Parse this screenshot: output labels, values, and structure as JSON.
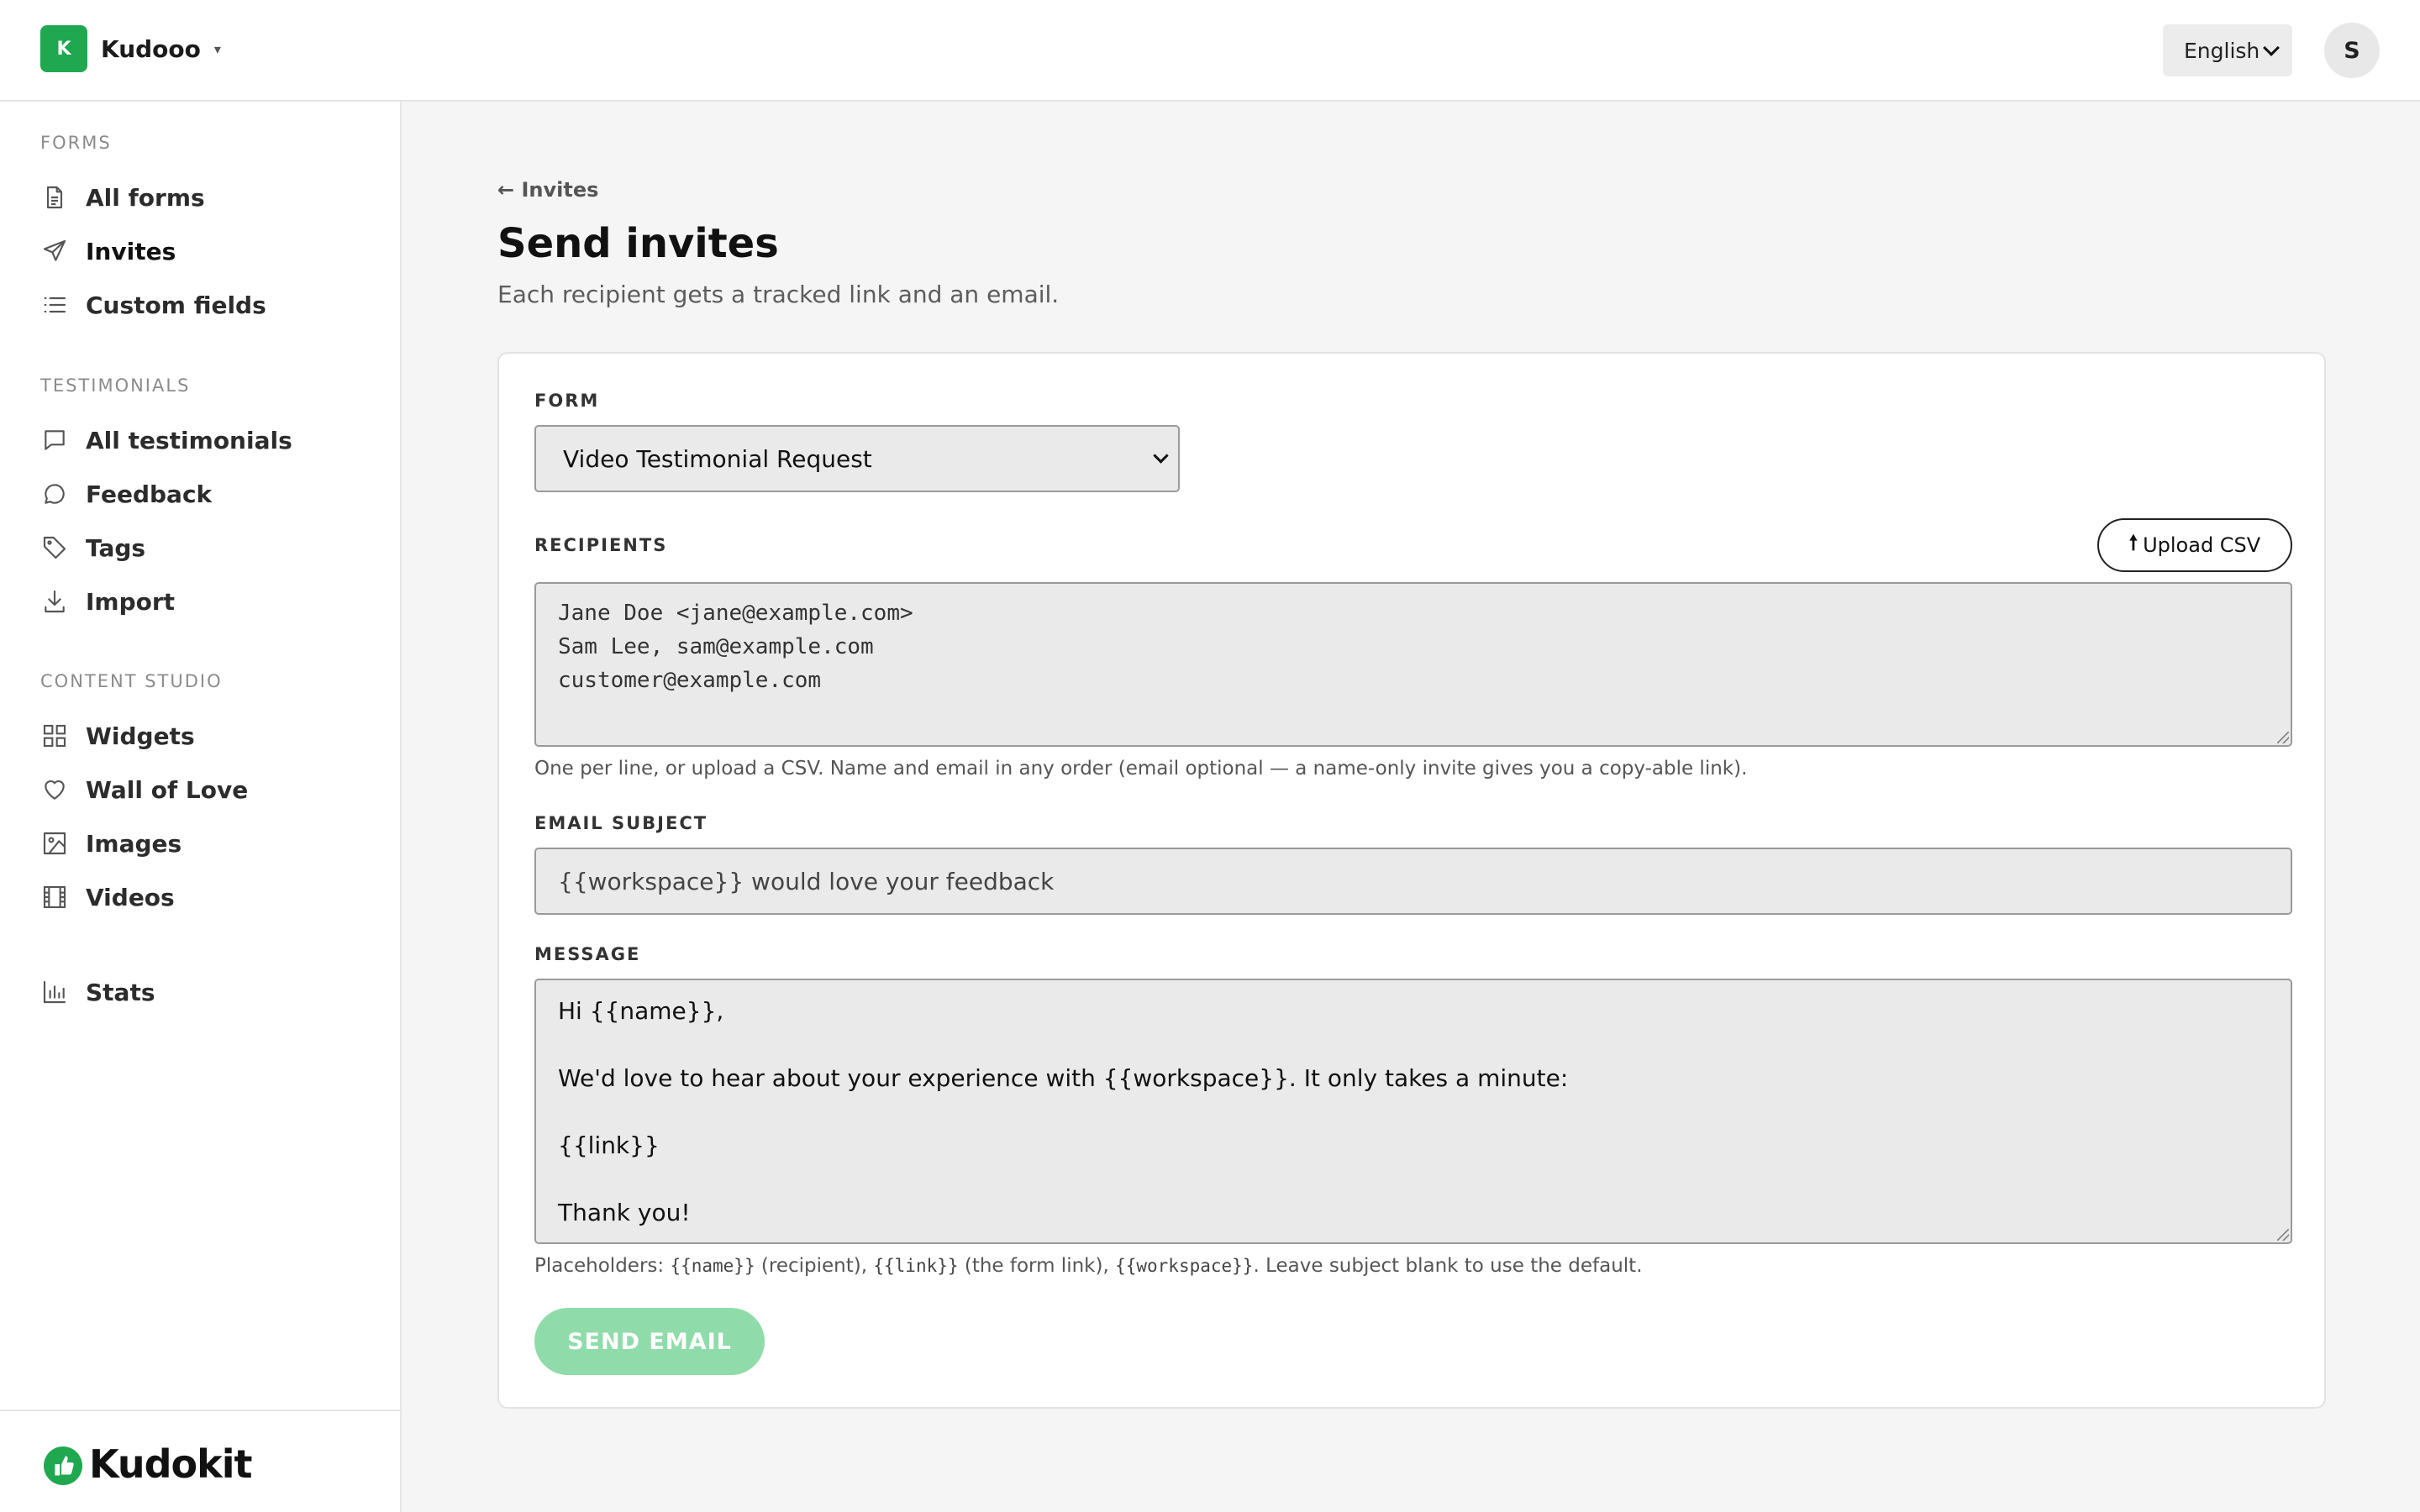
{
  "workspace": {
    "initial": "K",
    "name": "Kudooo",
    "caret": "▾"
  },
  "language": {
    "selected": "English"
  },
  "user": {
    "initial": "S"
  },
  "sidebar": {
    "sections": [
      {
        "title": "FORMS",
        "items": [
          {
            "label": "All forms",
            "icon": "document-icon"
          },
          {
            "label": "Invites",
            "icon": "paper-plane-icon",
            "active": true
          },
          {
            "label": "Custom fields",
            "icon": "list-icon"
          }
        ]
      },
      {
        "title": "TESTIMONIALS",
        "items": [
          {
            "label": "All testimonials",
            "icon": "message-square-icon"
          },
          {
            "label": "Feedback",
            "icon": "chat-bubble-icon"
          },
          {
            "label": "Tags",
            "icon": "tag-icon"
          },
          {
            "label": "Import",
            "icon": "download-icon"
          }
        ]
      },
      {
        "title": "CONTENT STUDIO",
        "items": [
          {
            "label": "Widgets",
            "icon": "grid-icon"
          },
          {
            "label": "Wall of Love",
            "icon": "heart-icon"
          },
          {
            "label": "Images",
            "icon": "image-icon"
          },
          {
            "label": "Videos",
            "icon": "film-icon"
          }
        ]
      }
    ],
    "stats": {
      "label": "Stats",
      "icon": "bar-chart-icon"
    },
    "brand": {
      "name": "Kudokit",
      "icon": "thumbs-up-icon"
    }
  },
  "page": {
    "back_label": "← Invites",
    "title": "Send invites",
    "subtitle": "Each recipient gets a tracked link and an email."
  },
  "form": {
    "form_label": "FORM",
    "form_selected": "Video Testimonial Request",
    "recipients_label": "RECIPIENTS",
    "upload_label": "Upload CSV",
    "recipients_lines": [
      "Jane Doe <jane@example.com>",
      "Sam Lee, sam@example.com",
      "customer@example.com"
    ],
    "recipients_hint": "One per line, or upload a CSV. Name and email in any order (email optional — a name-only invite gives you a copy-able link).",
    "subject_label": "EMAIL SUBJECT",
    "subject_value": "{{workspace}} would love your feedback",
    "message_label": "MESSAGE",
    "message_lines": [
      "Hi {{name}},",
      "We'd love to hear about your experience with {{workspace}}. It only takes a minute:",
      "{{link}}",
      "Thank you!"
    ],
    "placeholders_hint": {
      "prefix": "Placeholders: ",
      "name_code": "{{name}}",
      "name_desc": " (recipient), ",
      "link_code": "{{link}}",
      "link_desc": " (the form link), ",
      "ws_code": "{{workspace}}",
      "suffix": ". Leave subject blank to use the default."
    },
    "send_label": "SEND EMAIL"
  },
  "colors": {
    "accent": "#1fa84f",
    "send_disabled": "#8fdcaa"
  }
}
